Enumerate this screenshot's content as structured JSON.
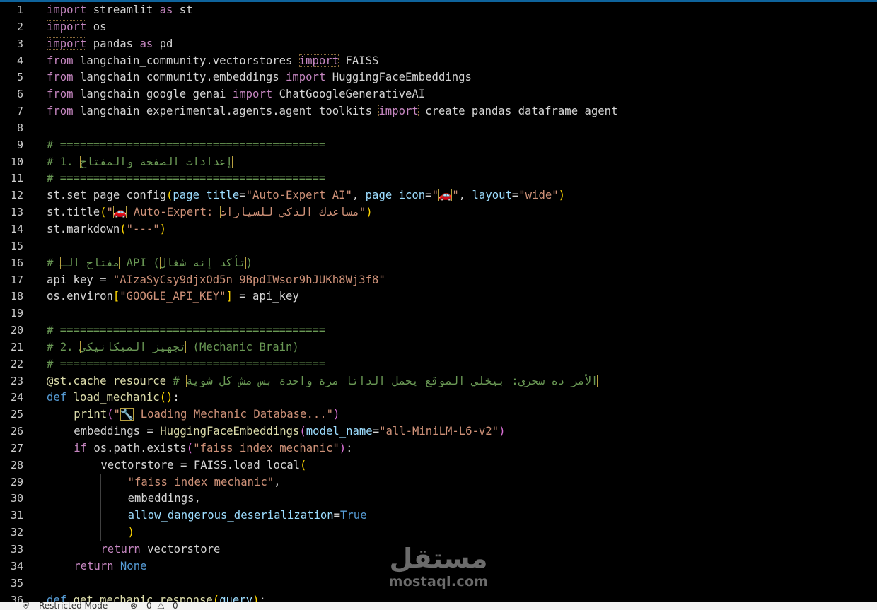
{
  "colors": {
    "background": "#000000",
    "keyword": "#c586c0",
    "builtin": "#569cd6",
    "function": "#dcdcaa",
    "parameter": "#9cdcfe",
    "string": "#ce9178",
    "comment": "#6a9955",
    "bracket": "#ffd700",
    "statusbar": "#f3f3f3"
  },
  "editor": {
    "language": "python",
    "active_line": 1,
    "lines": [
      {
        "n": "1",
        "indent": 0,
        "tokens": [
          {
            "t": "import",
            "c": "kw boxed"
          },
          {
            "t": " streamlit ",
            "c": "df"
          },
          {
            "t": "as",
            "c": "kw"
          },
          {
            "t": " st",
            "c": "df"
          }
        ]
      },
      {
        "n": "2",
        "indent": 0,
        "tokens": [
          {
            "t": "import",
            "c": "kw boxed"
          },
          {
            "t": " os",
            "c": "df"
          }
        ]
      },
      {
        "n": "3",
        "indent": 0,
        "tokens": [
          {
            "t": "import",
            "c": "kw boxed"
          },
          {
            "t": " pandas ",
            "c": "df"
          },
          {
            "t": "as",
            "c": "kw"
          },
          {
            "t": " pd",
            "c": "df"
          }
        ]
      },
      {
        "n": "4",
        "indent": 0,
        "tokens": [
          {
            "t": "from",
            "c": "kw"
          },
          {
            "t": " langchain_community.vectorstores ",
            "c": "df"
          },
          {
            "t": "import",
            "c": "kw boxed"
          },
          {
            "t": " FAISS",
            "c": "df"
          }
        ]
      },
      {
        "n": "5",
        "indent": 0,
        "tokens": [
          {
            "t": "from",
            "c": "kw"
          },
          {
            "t": " langchain_community.embeddings ",
            "c": "df"
          },
          {
            "t": "import",
            "c": "kw boxed"
          },
          {
            "t": " HuggingFaceEmbeddings",
            "c": "df"
          }
        ]
      },
      {
        "n": "6",
        "indent": 0,
        "tokens": [
          {
            "t": "from",
            "c": "kw"
          },
          {
            "t": " langchain_google_genai ",
            "c": "df"
          },
          {
            "t": "import",
            "c": "kw boxed"
          },
          {
            "t": " ChatGoogleGenerativeAI",
            "c": "df"
          }
        ]
      },
      {
        "n": "7",
        "indent": 0,
        "tokens": [
          {
            "t": "from",
            "c": "kw"
          },
          {
            "t": " langchain_experimental.agents.agent_toolkits ",
            "c": "df"
          },
          {
            "t": "import",
            "c": "kw boxed"
          },
          {
            "t": " create_pandas_dataframe_agent",
            "c": "df"
          }
        ]
      },
      {
        "n": "8",
        "indent": 0,
        "tokens": []
      },
      {
        "n": "9",
        "indent": 0,
        "tokens": [
          {
            "t": "# ========================================",
            "c": "cm"
          }
        ]
      },
      {
        "n": "10",
        "indent": 0,
        "tokens": [
          {
            "t": "# 1. ",
            "c": "cm"
          },
          {
            "t": "إعدادات الصفحة والمفتاح",
            "c": "cm ar"
          }
        ]
      },
      {
        "n": "11",
        "indent": 0,
        "tokens": [
          {
            "t": "# ========================================",
            "c": "cm"
          }
        ]
      },
      {
        "n": "12",
        "indent": 0,
        "tokens": [
          {
            "t": "st.set_page_config",
            "c": "df"
          },
          {
            "t": "(",
            "c": "pr"
          },
          {
            "t": "page_title",
            "c": "pm"
          },
          {
            "t": "=",
            "c": "df"
          },
          {
            "t": "\"Auto-Expert AI\"",
            "c": "st"
          },
          {
            "t": ", ",
            "c": "df"
          },
          {
            "t": "page_icon",
            "c": "pm"
          },
          {
            "t": "=",
            "c": "df"
          },
          {
            "t": "\"",
            "c": "st"
          },
          {
            "t": "🚗",
            "c": "st em"
          },
          {
            "t": "\"",
            "c": "st"
          },
          {
            "t": ", ",
            "c": "df"
          },
          {
            "t": "layout",
            "c": "pm"
          },
          {
            "t": "=",
            "c": "df"
          },
          {
            "t": "\"wide\"",
            "c": "st"
          },
          {
            "t": ")",
            "c": "pr"
          }
        ]
      },
      {
        "n": "13",
        "indent": 0,
        "tokens": [
          {
            "t": "st.title",
            "c": "df"
          },
          {
            "t": "(",
            "c": "pr"
          },
          {
            "t": "\"",
            "c": "st"
          },
          {
            "t": "🚗",
            "c": "st em"
          },
          {
            "t": " Auto-Expert: ",
            "c": "st"
          },
          {
            "t": "مساعدك الذكي للسيارات",
            "c": "st ar"
          },
          {
            "t": "\"",
            "c": "st"
          },
          {
            "t": ")",
            "c": "pr"
          }
        ]
      },
      {
        "n": "14",
        "indent": 0,
        "tokens": [
          {
            "t": "st.markdown",
            "c": "df"
          },
          {
            "t": "(",
            "c": "pr"
          },
          {
            "t": "\"---\"",
            "c": "st"
          },
          {
            "t": ")",
            "c": "pr"
          }
        ]
      },
      {
        "n": "15",
        "indent": 0,
        "tokens": []
      },
      {
        "n": "16",
        "indent": 0,
        "tokens": [
          {
            "t": "# ",
            "c": "cm"
          },
          {
            "t": "مفتاح الـ",
            "c": "cm ar"
          },
          {
            "t": " API (",
            "c": "cm"
          },
          {
            "t": "تأكد إنه شغال",
            "c": "cm ar"
          },
          {
            "t": ")",
            "c": "cm"
          }
        ]
      },
      {
        "n": "17",
        "indent": 0,
        "tokens": [
          {
            "t": "api_key = ",
            "c": "df"
          },
          {
            "t": "\"AIzaSyCsy9djxOd5n_9BpdIWsor9hJUKh8Wj3f8\"",
            "c": "st"
          }
        ]
      },
      {
        "n": "18",
        "indent": 0,
        "tokens": [
          {
            "t": "os.environ",
            "c": "df"
          },
          {
            "t": "[",
            "c": "pr"
          },
          {
            "t": "\"GOOGLE_API_KEY\"",
            "c": "st"
          },
          {
            "t": "]",
            "c": "pr"
          },
          {
            "t": " = api_key",
            "c": "df"
          }
        ]
      },
      {
        "n": "19",
        "indent": 0,
        "tokens": []
      },
      {
        "n": "20",
        "indent": 0,
        "tokens": [
          {
            "t": "# ========================================",
            "c": "cm"
          }
        ]
      },
      {
        "n": "21",
        "indent": 0,
        "tokens": [
          {
            "t": "# 2. ",
            "c": "cm"
          },
          {
            "t": "تجهيز الميكانيكي",
            "c": "cm ar"
          },
          {
            "t": " (Mechanic Brain)",
            "c": "cm"
          }
        ]
      },
      {
        "n": "22",
        "indent": 0,
        "tokens": [
          {
            "t": "# ========================================",
            "c": "cm"
          }
        ]
      },
      {
        "n": "23",
        "indent": 0,
        "tokens": [
          {
            "t": "@st.cache_resource",
            "c": "fn"
          },
          {
            "t": " # ",
            "c": "cm"
          },
          {
            "t": "الأمر ده سحري: بيخلي الموقع يحمل الداتا مرة واحدة بس مش كل شوية",
            "c": "cm ar"
          }
        ]
      },
      {
        "n": "24",
        "indent": 0,
        "tokens": [
          {
            "t": "def",
            "c": "bl"
          },
          {
            "t": " ",
            "c": "df"
          },
          {
            "t": "load_mechanic",
            "c": "fn"
          },
          {
            "t": "(",
            "c": "pr"
          },
          {
            "t": ")",
            "c": "pr"
          },
          {
            "t": ":",
            "c": "df"
          }
        ]
      },
      {
        "n": "25",
        "indent": 1,
        "tokens": [
          {
            "t": "print",
            "c": "fn"
          },
          {
            "t": "(",
            "c": "pr2"
          },
          {
            "t": "\"",
            "c": "st"
          },
          {
            "t": "🔧",
            "c": "st em"
          },
          {
            "t": " Loading Mechanic Database...\"",
            "c": "st"
          },
          {
            "t": ")",
            "c": "pr2"
          }
        ]
      },
      {
        "n": "26",
        "indent": 1,
        "tokens": [
          {
            "t": "embeddings = ",
            "c": "df"
          },
          {
            "t": "HuggingFaceEmbeddings",
            "c": "fn"
          },
          {
            "t": "(",
            "c": "pr2"
          },
          {
            "t": "model_name",
            "c": "pm"
          },
          {
            "t": "=",
            "c": "df"
          },
          {
            "t": "\"all-MiniLM-L6-v2\"",
            "c": "st"
          },
          {
            "t": ")",
            "c": "pr2"
          }
        ]
      },
      {
        "n": "27",
        "indent": 1,
        "tokens": [
          {
            "t": "if",
            "c": "kw"
          },
          {
            "t": " os.path.exists",
            "c": "df"
          },
          {
            "t": "(",
            "c": "pr2"
          },
          {
            "t": "\"faiss_index_mechanic\"",
            "c": "st"
          },
          {
            "t": ")",
            "c": "pr2"
          },
          {
            "t": ":",
            "c": "df"
          }
        ]
      },
      {
        "n": "28",
        "indent": 2,
        "tokens": [
          {
            "t": "vectorstore = FAISS.load_local",
            "c": "df"
          },
          {
            "t": "(",
            "c": "pr"
          }
        ]
      },
      {
        "n": "29",
        "indent": 3,
        "tokens": [
          {
            "t": "\"faiss_index_mechanic\"",
            "c": "st"
          },
          {
            "t": ",",
            "c": "df"
          }
        ]
      },
      {
        "n": "30",
        "indent": 3,
        "tokens": [
          {
            "t": "embeddings,",
            "c": "df"
          }
        ]
      },
      {
        "n": "31",
        "indent": 3,
        "tokens": [
          {
            "t": "allow_dangerous_deserialization",
            "c": "pm"
          },
          {
            "t": "=",
            "c": "df"
          },
          {
            "t": "True",
            "c": "bl"
          }
        ]
      },
      {
        "n": "32",
        "indent": 3,
        "tokens": [
          {
            "t": ")",
            "c": "pr"
          }
        ]
      },
      {
        "n": "33",
        "indent": 2,
        "tokens": [
          {
            "t": "return",
            "c": "kw"
          },
          {
            "t": " vectorstore",
            "c": "df"
          }
        ]
      },
      {
        "n": "34",
        "indent": 1,
        "tokens": [
          {
            "t": "return",
            "c": "kw"
          },
          {
            "t": " ",
            "c": "df"
          },
          {
            "t": "None",
            "c": "bl"
          }
        ]
      },
      {
        "n": "35",
        "indent": 0,
        "tokens": []
      },
      {
        "n": "36",
        "indent": 0,
        "tokens": [
          {
            "t": "def",
            "c": "bl"
          },
          {
            "t": " ",
            "c": "df"
          },
          {
            "t": "get_mechanic_response",
            "c": "fn"
          },
          {
            "t": "(",
            "c": "pr"
          },
          {
            "t": "query",
            "c": "pm"
          },
          {
            "t": ")",
            "c": "pr"
          },
          {
            "t": ":",
            "c": "df"
          }
        ]
      }
    ]
  },
  "statusbar": {
    "shield_icon": "shield-icon",
    "mode_label": "Restricted Mode",
    "errors_icon": "error-icon",
    "errors_count": "0",
    "warnings_icon": "warning-icon",
    "warnings_count": "0"
  },
  "watermark": {
    "arabic": "مستقل",
    "latin": "mostaql.com"
  }
}
